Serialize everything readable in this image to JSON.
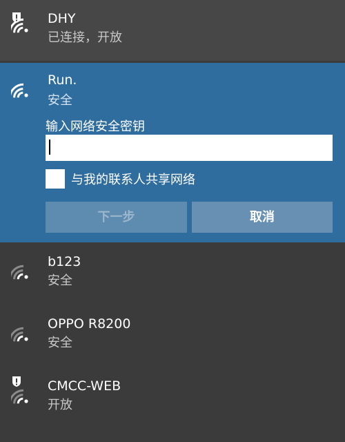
{
  "networks": [
    {
      "ssid": "DHY",
      "status": "已连接，开放",
      "secured": false,
      "connected": true,
      "icon": "wifi-warning-icon"
    },
    {
      "ssid": "Run.",
      "status": "安全",
      "secured": true,
      "expanded": true,
      "icon": "wifi-icon",
      "key_label": "输入网络安全密钥",
      "key_value": "",
      "share_label": "与我的联系人共享网络",
      "share_checked": false,
      "next_label": "下一步",
      "cancel_label": "取消"
    },
    {
      "ssid": "b123",
      "status": "安全",
      "secured": true,
      "icon": "wifi-icon"
    },
    {
      "ssid": "OPPO R8200",
      "status": "安全",
      "secured": true,
      "icon": "wifi-icon"
    },
    {
      "ssid": "CMCC-WEB",
      "status": "开放",
      "secured": false,
      "icon": "wifi-warning-icon"
    }
  ],
  "colors": {
    "background": "#3b3b3b",
    "connected_row": "#474747",
    "accent": "#2f6d9f",
    "button": "#6790b3",
    "button_disabled": "#5e8bb0"
  }
}
